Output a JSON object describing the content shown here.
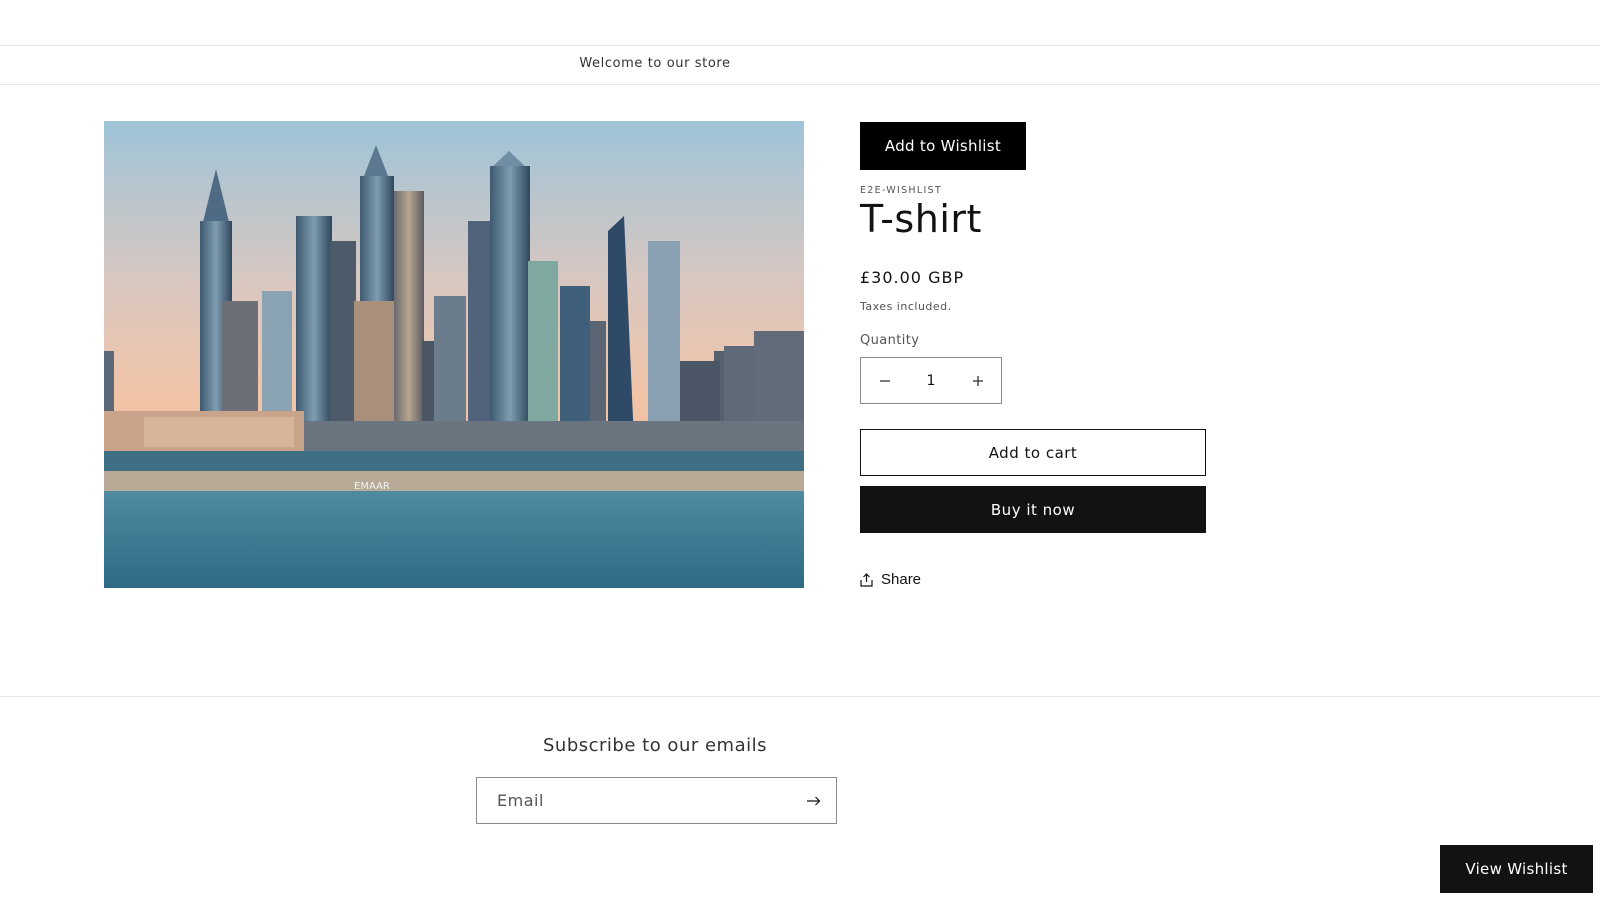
{
  "announcement": {
    "text": "Welcome to our store"
  },
  "product": {
    "image_alt": "Skyline of tall towers beside the sea",
    "image_watermark": "EMAAR",
    "wishlist_button": "Add to Wishlist",
    "vendor": "E2E-WISHLIST",
    "title": "T-shirt",
    "price": "£30.00 GBP",
    "tax_note": "Taxes included.",
    "quantity_label": "Quantity",
    "quantity_value": "1",
    "add_to_cart": "Add to cart",
    "buy_now": "Buy it now",
    "share": "Share"
  },
  "newsletter": {
    "heading": "Subscribe to our emails",
    "email_placeholder": "Email"
  },
  "floating": {
    "view_wishlist": "View Wishlist"
  },
  "icons": {
    "minus": "minus-icon",
    "plus": "plus-icon",
    "share": "share-icon",
    "arrow": "arrow-right-icon"
  },
  "colors": {
    "primary_button": "#121212",
    "border": "#8a8a8a",
    "divider": "#e6e6e6"
  }
}
